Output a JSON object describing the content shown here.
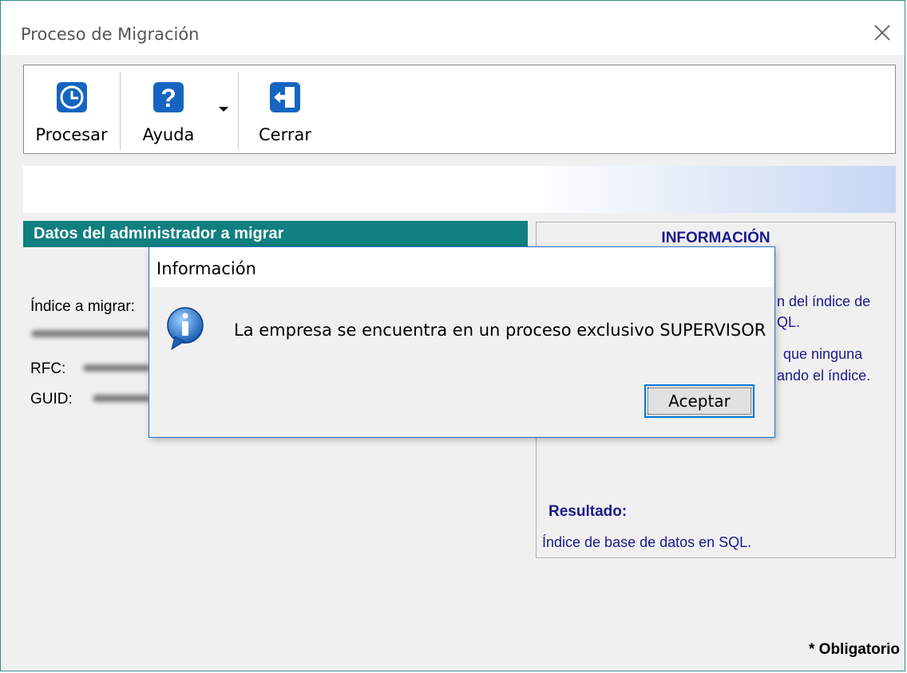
{
  "window": {
    "title": "Proceso de Migración"
  },
  "toolbar": {
    "buttons": [
      {
        "label": "Procesar",
        "icon": "clock-icon"
      },
      {
        "label": "Ayuda",
        "icon": "help-icon"
      },
      {
        "label": "Cerrar",
        "icon": "exit-door-icon"
      }
    ]
  },
  "left_panel": {
    "header": "Datos del administrador a migrar",
    "index_label": "Índice a migrar:",
    "rfc_label": "RFC:",
    "guid_label": "GUID:"
  },
  "info_panel": {
    "title": "INFORMACIÓN",
    "line1": "n del índice de",
    "line2": "QL.",
    "line3": "que ninguna",
    "line4": "ando el índice.",
    "result_title": "Resultado:",
    "result_text": "Índice de base de datos en SQL."
  },
  "footer": {
    "mandatory": "* Obligatorio"
  },
  "dialog": {
    "title": "Información",
    "message": "La empresa se encuentra en un proceso exclusivo SUPERVISOR",
    "ok_label": "Aceptar",
    "icon": "info-icon"
  },
  "colors": {
    "section_header": "#0f7f7f",
    "info_text": "#1a1a8c",
    "dialog_border": "#1f6fc8",
    "button_focus": "#0078d7"
  }
}
